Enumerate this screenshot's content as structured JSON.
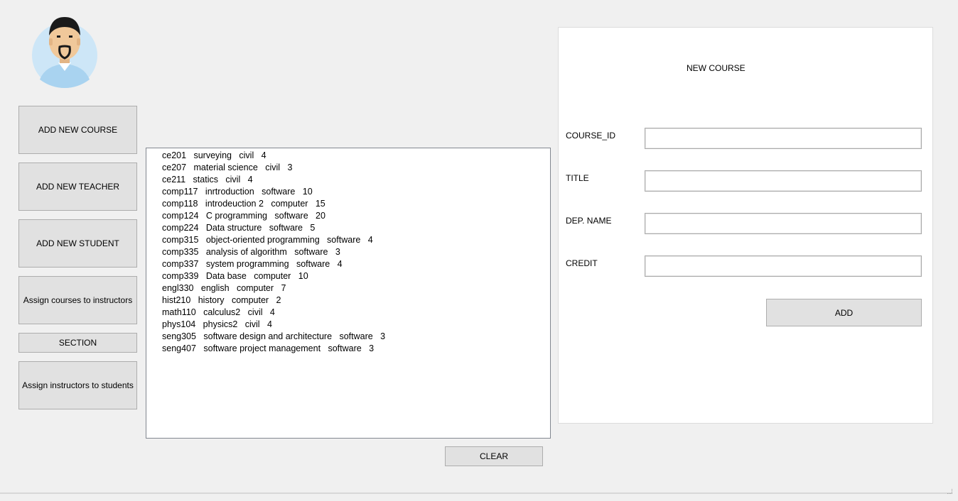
{
  "nav": {
    "add_course": "ADD NEW COURSE",
    "add_teacher": "ADD NEW TEACHER",
    "add_student": "ADD NEW STUDENT",
    "assign_courses": "Assign courses to instructors",
    "section": "SECTION",
    "assign_instructors": "Assign instructors to students"
  },
  "avatar_icon": "user-avatar-icon",
  "course_list": [
    "ce201   surveying   civil   4",
    "ce207   material science   civil   3",
    "ce211   statics   civil   4",
    "comp117   inrtroduction   software   10",
    "comp118   introdeuction 2   computer   15",
    "comp124   C programming   software   20",
    "comp224   Data structure   software   5",
    "comp315   object-oriented programming   software   4",
    "comp335   analysis of algorithm   software   3",
    "comp337   system programming   software   4",
    "comp339   Data base   computer   10",
    "engl330   english   computer   7",
    "hist210   history   computer   2",
    "math110   calculus2   civil   4",
    "phys104   physics2   civil   4",
    "seng305   software design and architecture   software   3",
    "seng407   software project management   software   3"
  ],
  "clear_label": "CLEAR",
  "form": {
    "title": "NEW COURSE",
    "course_id_label": "COURSE_ID",
    "course_id_value": "",
    "title_label": "TITLE",
    "title_value": "",
    "dep_label": "DEP. NAME",
    "dep_value": "",
    "credit_label": "CREDIT",
    "credit_value": "",
    "add_label": "ADD"
  }
}
